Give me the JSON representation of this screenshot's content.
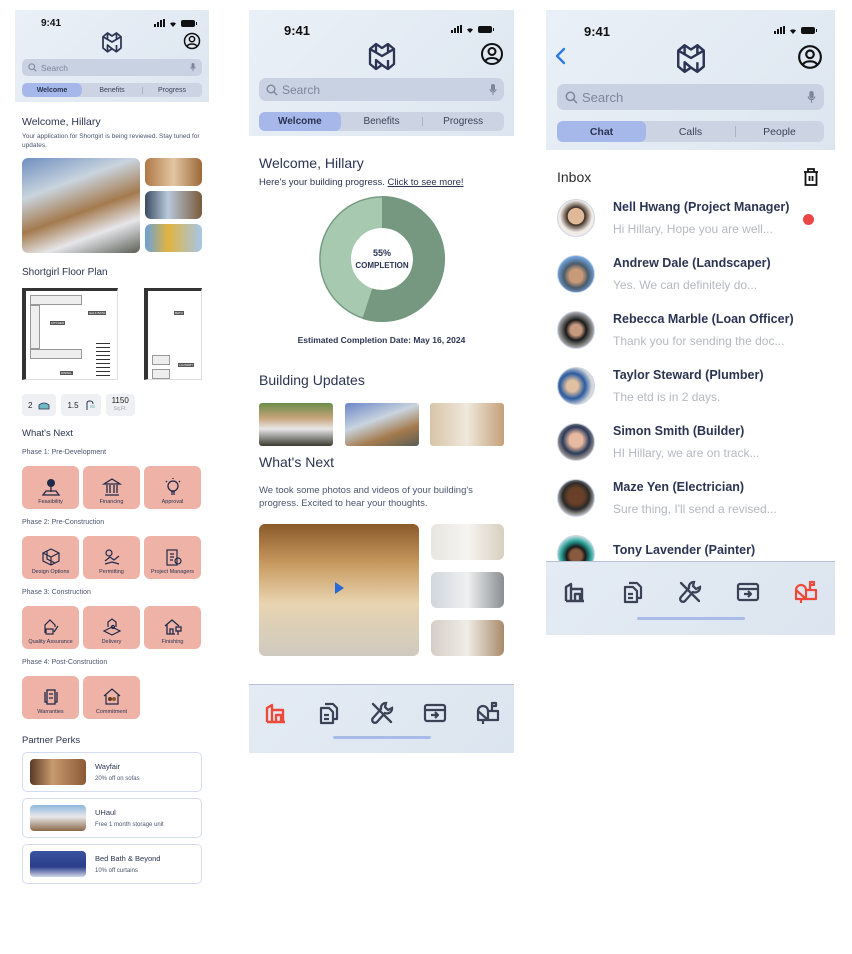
{
  "status_bar": {
    "time": "9:41"
  },
  "screens": {
    "welcome_benefits": {
      "search": {
        "placeholder": "Search"
      },
      "tabs": [
        {
          "label": "Welcome",
          "active": true
        },
        {
          "label": "Benefits",
          "active": false
        },
        {
          "label": "Progress",
          "active": false
        }
      ],
      "welcome_title": "Welcome, Hillary",
      "welcome_subtitle": "Your application for Shortgirl is being reviewed. Stay tuned for updates.",
      "floor_plan_title": "Shortgirl Floor Plan",
      "floor_plan_labels": [
        "KITCHEN",
        "HALF BATH",
        "DINING",
        "BATH",
        "LAUNDRY"
      ],
      "stats": {
        "beds": "2",
        "baths": "1.5",
        "area": "1150",
        "area_unit": "Sq.Ft."
      },
      "whats_next_title": "What's Next",
      "phases": [
        {
          "title": "Phase 1: Pre-Development",
          "items": [
            {
              "label": "Feasibility",
              "icon": "tree-icon"
            },
            {
              "label": "Financing",
              "icon": "bank-icon"
            },
            {
              "label": "Approval",
              "icon": "lightbulb-icon"
            }
          ]
        },
        {
          "title": "Phase 2: Pre-Construction",
          "items": [
            {
              "label": "Design Options",
              "icon": "cube-icon"
            },
            {
              "label": "Permitting",
              "icon": "handshake-icon"
            },
            {
              "label": "Project Managers",
              "icon": "clipboard-icon"
            }
          ]
        },
        {
          "title": "Phase 3: Construction",
          "items": [
            {
              "label": "Quality Assurance",
              "icon": "house-check-icon"
            },
            {
              "label": "Delivery",
              "icon": "location-pin-icon"
            },
            {
              "label": "Finishing",
              "icon": "house-paint-icon"
            }
          ]
        },
        {
          "title": "Phase 4: Post-Construction",
          "items": [
            {
              "label": "Warranties",
              "icon": "document-cycle-icon"
            },
            {
              "label": "Commitment",
              "icon": "house-family-icon"
            }
          ]
        }
      ],
      "partner_perks_title": "Partner Perks",
      "perks": [
        {
          "name": "Wayfair",
          "desc": "20% off on sofas"
        },
        {
          "name": "UHaul",
          "desc": "Free 1 month storage unit"
        },
        {
          "name": "Bed Bath & Beyond",
          "desc": "10% off curtains"
        }
      ]
    },
    "progress": {
      "search": {
        "placeholder": "Search"
      },
      "tabs": [
        {
          "label": "Welcome",
          "active": true
        },
        {
          "label": "Benefits",
          "active": false
        },
        {
          "label": "Progress",
          "active": false
        }
      ],
      "welcome_title": "Welcome, Hillary",
      "subtitle": "Here's your building progress.",
      "subtitle_link": "Click to see more!",
      "completion": {
        "percent": 55,
        "label_value": "55%",
        "label_text": "COMPLETION",
        "done_color": "#769880",
        "remaining_color": "#a6c9b0"
      },
      "estimated_completion": "Estimated Completion Date: May 16, 2024",
      "building_updates_title": "Building Updates",
      "whats_next_title": "What's Next",
      "whats_next_desc": "We took some photos and videos of your building's progress. Excited to hear your thoughts."
    },
    "inbox": {
      "search": {
        "placeholder": "Search"
      },
      "tabs": [
        {
          "label": "Chat",
          "active": true
        },
        {
          "label": "Calls",
          "active": false
        },
        {
          "label": "People",
          "active": false
        }
      ],
      "title": "Inbox",
      "messages": [
        {
          "name": "Nell Hwang (Project Manager)",
          "preview": "Hi Hillary, Hope you are well...",
          "unread": true
        },
        {
          "name": "Andrew Dale (Landscaper)",
          "preview": "Yes. We can definitely do...",
          "unread": false
        },
        {
          "name": "Rebecca Marble (Loan Officer)",
          "preview": "Thank you for sending the doc...",
          "unread": false
        },
        {
          "name": "Taylor Steward (Plumber)",
          "preview": "The etd is in 2 days.",
          "unread": false
        },
        {
          "name": "Simon Smith (Builder)",
          "preview": "HI Hillary, we are on track...",
          "unread": false
        },
        {
          "name": "Maze Yen (Electrician)",
          "preview": "Sure thing, I'll send a revised...",
          "unread": false
        },
        {
          "name": "Tony Lavender (Painter)",
          "preview": "",
          "unread": false
        }
      ]
    }
  },
  "tab_bar": {
    "items": [
      "home-icon",
      "documents-icon",
      "tools-icon",
      "payment-icon",
      "mailbox-icon"
    ],
    "active_color": "#ee4a3c",
    "inactive_color": "#3b4256"
  },
  "colors": {
    "accent_blue": "#a6b8e9",
    "tile_salmon": "#efb2a7",
    "text_navy": "#2b3452"
  }
}
